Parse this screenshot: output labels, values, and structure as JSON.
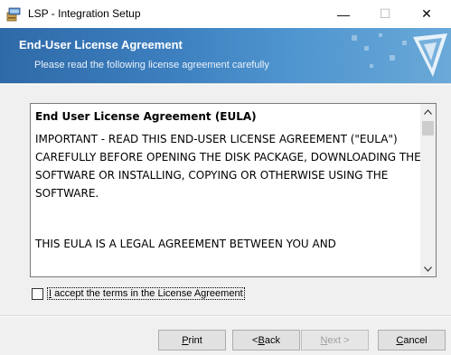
{
  "window": {
    "title": "LSP - Integration Setup",
    "min_symbol": "—",
    "max_symbol": "☐",
    "close_symbol": "✕"
  },
  "banner": {
    "title": "End-User License Agreement",
    "subtitle": "Please read the following license agreement carefully"
  },
  "license": {
    "heading": "End User License Agreement (EULA)",
    "paragraphs": [
      "IMPORTANT - READ THIS END-USER LICENSE AGREEMENT (\"EULA\") CAREFULLY BEFORE OPENING THE DISK PACKAGE, DOWNLOADING THE SOFTWARE OR INSTALLING, COPYING OR OTHERWISE USING THE SOFTWARE.",
      "THIS EULA IS A LEGAL AGREEMENT BETWEEN YOU AND"
    ]
  },
  "accept": {
    "label_accel": "I",
    "label_rest": " accept the terms in the License Agreement",
    "checked": false
  },
  "buttons": {
    "print": {
      "accel": "P",
      "rest": "rint"
    },
    "back": {
      "prefix": "< ",
      "accel": "B",
      "rest": "ack"
    },
    "next": {
      "accel": "N",
      "rest": "ext >"
    },
    "cancel": {
      "accel": "C",
      "rest": "ancel"
    }
  },
  "colors": {
    "banner_start": "#2f6aa8",
    "banner_end": "#6aa9d8"
  },
  "icons": {
    "app": "installer-icon",
    "banner": "installer-logo"
  }
}
